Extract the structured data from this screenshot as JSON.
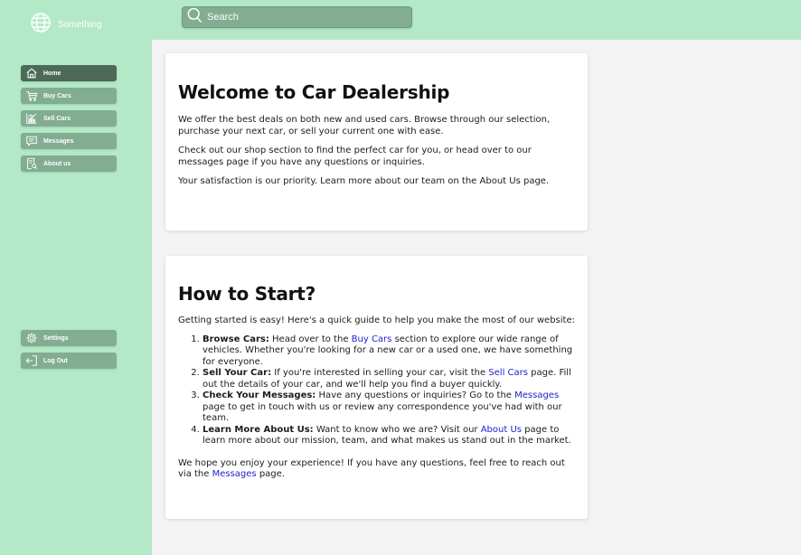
{
  "header": {
    "brand_name": "Something",
    "search_placeholder": "Search"
  },
  "sidebar": {
    "items": [
      {
        "label": "Home",
        "icon": "home-icon",
        "active": true
      },
      {
        "label": "Buy Cars",
        "icon": "cart-icon"
      },
      {
        "label": "Sell Cars",
        "icon": "chart-icon"
      },
      {
        "label": "Messages",
        "icon": "message-icon"
      },
      {
        "label": "About us",
        "icon": "document-search-icon"
      }
    ],
    "bottom_items": [
      {
        "label": "Settings",
        "icon": "gear-icon"
      },
      {
        "label": "Log Out",
        "icon": "logout-icon"
      }
    ]
  },
  "welcome": {
    "title": "Welcome to Car Dealership",
    "p1": "We offer the best deals on both new and used cars. Browse through our selection, purchase your next car, or sell your current one with ease.",
    "p2": "Check out our shop section to find the perfect car for you, or head over to our messages page if you have any questions or inquiries.",
    "p3": "Your satisfaction is our priority. Learn more about our team on the About Us page."
  },
  "start": {
    "title": "How to Start?",
    "intro": "Getting started is easy! Here's a quick guide to help you make the most of our website:",
    "steps": [
      {
        "bold": "Browse Cars:",
        "pre": " Head over to the ",
        "link": "Buy Cars",
        "post": " section to explore our wide range of vehicles. Whether you're looking for a new car or a used one, we have something for everyone."
      },
      {
        "bold": "Sell Your Car:",
        "pre": " If you're interested in selling your car, visit the ",
        "link": "Sell Cars",
        "post": " page. Fill out the details of your car, and we'll help you find a buyer quickly."
      },
      {
        "bold": "Check Your Messages:",
        "pre": " Have any questions or inquiries? Go to the ",
        "link": "Messages",
        "post": " page to get in touch with us or review any correspondence you've had with our team."
      },
      {
        "bold": "Learn More About Us:",
        "pre": " Want to know who we are? Visit our ",
        "link": "About Us",
        "post": " page to learn more about our mission, team, and what makes us stand out in the market."
      }
    ],
    "outro_pre": "We hope you enjoy your experience! If you have any questions, feel free to reach out via the ",
    "outro_link": "Messages",
    "outro_post": " page."
  },
  "colors": {
    "header_bg": "#b3e9c7",
    "nav_bg": "#82ad91",
    "nav_active_bg": "#4d6a58",
    "link": "#2222cc"
  }
}
